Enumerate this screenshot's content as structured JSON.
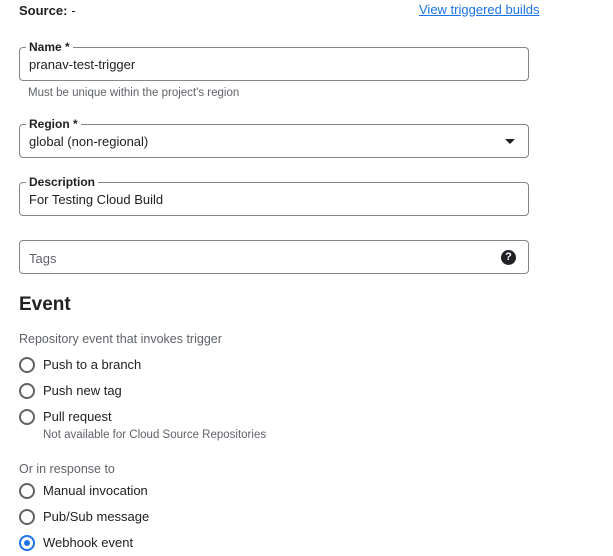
{
  "header": {
    "source_label": "Source:",
    "source_value": "-",
    "view_triggered_builds": "View triggered builds"
  },
  "name_field": {
    "label": "Name *",
    "value": "pranav-test-trigger",
    "hint": "Must be unique within the project's region"
  },
  "region_field": {
    "label": "Region *",
    "value": "global (non-regional)",
    "icon": "dropdown-caret"
  },
  "description_field": {
    "label": "Description",
    "value": "For Testing Cloud Build"
  },
  "tags_field": {
    "placeholder": "Tags",
    "icon": "help-icon"
  },
  "event": {
    "title": "Event",
    "repo_subhead": "Repository event that invokes trigger",
    "repo_options": [
      {
        "label": "Push to a branch",
        "checked": false
      },
      {
        "label": "Push new tag",
        "checked": false
      },
      {
        "label": "Pull request",
        "checked": false,
        "note": "Not available for Cloud Source Repositories"
      }
    ],
    "response_subhead": "Or in response to",
    "response_options": [
      {
        "label": "Manual invocation",
        "checked": false
      },
      {
        "label": "Pub/Sub message",
        "checked": false
      },
      {
        "label": "Webhook event",
        "checked": true
      }
    ]
  },
  "colors": {
    "accent": "#1a73e8",
    "text": "#202124",
    "secondary_text": "#5f6368",
    "border": "#80868b"
  }
}
